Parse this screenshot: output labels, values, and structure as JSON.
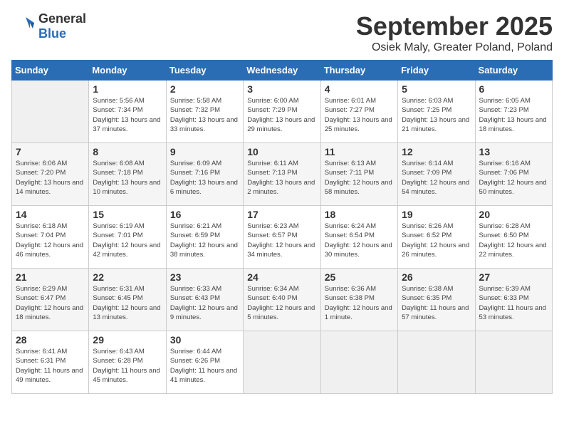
{
  "header": {
    "logo_general": "General",
    "logo_blue": "Blue",
    "month_year": "September 2025",
    "location": "Osiek Maly, Greater Poland, Poland"
  },
  "weekdays": [
    "Sunday",
    "Monday",
    "Tuesday",
    "Wednesday",
    "Thursday",
    "Friday",
    "Saturday"
  ],
  "weeks": [
    [
      {
        "day": "",
        "sunrise": "",
        "sunset": "",
        "daylight": "",
        "empty": true
      },
      {
        "day": "1",
        "sunrise": "Sunrise: 5:56 AM",
        "sunset": "Sunset: 7:34 PM",
        "daylight": "Daylight: 13 hours and 37 minutes."
      },
      {
        "day": "2",
        "sunrise": "Sunrise: 5:58 AM",
        "sunset": "Sunset: 7:32 PM",
        "daylight": "Daylight: 13 hours and 33 minutes."
      },
      {
        "day": "3",
        "sunrise": "Sunrise: 6:00 AM",
        "sunset": "Sunset: 7:29 PM",
        "daylight": "Daylight: 13 hours and 29 minutes."
      },
      {
        "day": "4",
        "sunrise": "Sunrise: 6:01 AM",
        "sunset": "Sunset: 7:27 PM",
        "daylight": "Daylight: 13 hours and 25 minutes."
      },
      {
        "day": "5",
        "sunrise": "Sunrise: 6:03 AM",
        "sunset": "Sunset: 7:25 PM",
        "daylight": "Daylight: 13 hours and 21 minutes."
      },
      {
        "day": "6",
        "sunrise": "Sunrise: 6:05 AM",
        "sunset": "Sunset: 7:23 PM",
        "daylight": "Daylight: 13 hours and 18 minutes."
      }
    ],
    [
      {
        "day": "7",
        "sunrise": "Sunrise: 6:06 AM",
        "sunset": "Sunset: 7:20 PM",
        "daylight": "Daylight: 13 hours and 14 minutes."
      },
      {
        "day": "8",
        "sunrise": "Sunrise: 6:08 AM",
        "sunset": "Sunset: 7:18 PM",
        "daylight": "Daylight: 13 hours and 10 minutes."
      },
      {
        "day": "9",
        "sunrise": "Sunrise: 6:09 AM",
        "sunset": "Sunset: 7:16 PM",
        "daylight": "Daylight: 13 hours and 6 minutes."
      },
      {
        "day": "10",
        "sunrise": "Sunrise: 6:11 AM",
        "sunset": "Sunset: 7:13 PM",
        "daylight": "Daylight: 13 hours and 2 minutes."
      },
      {
        "day": "11",
        "sunrise": "Sunrise: 6:13 AM",
        "sunset": "Sunset: 7:11 PM",
        "daylight": "Daylight: 12 hours and 58 minutes."
      },
      {
        "day": "12",
        "sunrise": "Sunrise: 6:14 AM",
        "sunset": "Sunset: 7:09 PM",
        "daylight": "Daylight: 12 hours and 54 minutes."
      },
      {
        "day": "13",
        "sunrise": "Sunrise: 6:16 AM",
        "sunset": "Sunset: 7:06 PM",
        "daylight": "Daylight: 12 hours and 50 minutes."
      }
    ],
    [
      {
        "day": "14",
        "sunrise": "Sunrise: 6:18 AM",
        "sunset": "Sunset: 7:04 PM",
        "daylight": "Daylight: 12 hours and 46 minutes."
      },
      {
        "day": "15",
        "sunrise": "Sunrise: 6:19 AM",
        "sunset": "Sunset: 7:01 PM",
        "daylight": "Daylight: 12 hours and 42 minutes."
      },
      {
        "day": "16",
        "sunrise": "Sunrise: 6:21 AM",
        "sunset": "Sunset: 6:59 PM",
        "daylight": "Daylight: 12 hours and 38 minutes."
      },
      {
        "day": "17",
        "sunrise": "Sunrise: 6:23 AM",
        "sunset": "Sunset: 6:57 PM",
        "daylight": "Daylight: 12 hours and 34 minutes."
      },
      {
        "day": "18",
        "sunrise": "Sunrise: 6:24 AM",
        "sunset": "Sunset: 6:54 PM",
        "daylight": "Daylight: 12 hours and 30 minutes."
      },
      {
        "day": "19",
        "sunrise": "Sunrise: 6:26 AM",
        "sunset": "Sunset: 6:52 PM",
        "daylight": "Daylight: 12 hours and 26 minutes."
      },
      {
        "day": "20",
        "sunrise": "Sunrise: 6:28 AM",
        "sunset": "Sunset: 6:50 PM",
        "daylight": "Daylight: 12 hours and 22 minutes."
      }
    ],
    [
      {
        "day": "21",
        "sunrise": "Sunrise: 6:29 AM",
        "sunset": "Sunset: 6:47 PM",
        "daylight": "Daylight: 12 hours and 18 minutes."
      },
      {
        "day": "22",
        "sunrise": "Sunrise: 6:31 AM",
        "sunset": "Sunset: 6:45 PM",
        "daylight": "Daylight: 12 hours and 13 minutes."
      },
      {
        "day": "23",
        "sunrise": "Sunrise: 6:33 AM",
        "sunset": "Sunset: 6:43 PM",
        "daylight": "Daylight: 12 hours and 9 minutes."
      },
      {
        "day": "24",
        "sunrise": "Sunrise: 6:34 AM",
        "sunset": "Sunset: 6:40 PM",
        "daylight": "Daylight: 12 hours and 5 minutes."
      },
      {
        "day": "25",
        "sunrise": "Sunrise: 6:36 AM",
        "sunset": "Sunset: 6:38 PM",
        "daylight": "Daylight: 12 hours and 1 minute."
      },
      {
        "day": "26",
        "sunrise": "Sunrise: 6:38 AM",
        "sunset": "Sunset: 6:35 PM",
        "daylight": "Daylight: 11 hours and 57 minutes."
      },
      {
        "day": "27",
        "sunrise": "Sunrise: 6:39 AM",
        "sunset": "Sunset: 6:33 PM",
        "daylight": "Daylight: 11 hours and 53 minutes."
      }
    ],
    [
      {
        "day": "28",
        "sunrise": "Sunrise: 6:41 AM",
        "sunset": "Sunset: 6:31 PM",
        "daylight": "Daylight: 11 hours and 49 minutes."
      },
      {
        "day": "29",
        "sunrise": "Sunrise: 6:43 AM",
        "sunset": "Sunset: 6:28 PM",
        "daylight": "Daylight: 11 hours and 45 minutes."
      },
      {
        "day": "30",
        "sunrise": "Sunrise: 6:44 AM",
        "sunset": "Sunset: 6:26 PM",
        "daylight": "Daylight: 11 hours and 41 minutes."
      },
      {
        "day": "",
        "sunrise": "",
        "sunset": "",
        "daylight": "",
        "empty": true
      },
      {
        "day": "",
        "sunrise": "",
        "sunset": "",
        "daylight": "",
        "empty": true
      },
      {
        "day": "",
        "sunrise": "",
        "sunset": "",
        "daylight": "",
        "empty": true
      },
      {
        "day": "",
        "sunrise": "",
        "sunset": "",
        "daylight": "",
        "empty": true
      }
    ]
  ]
}
